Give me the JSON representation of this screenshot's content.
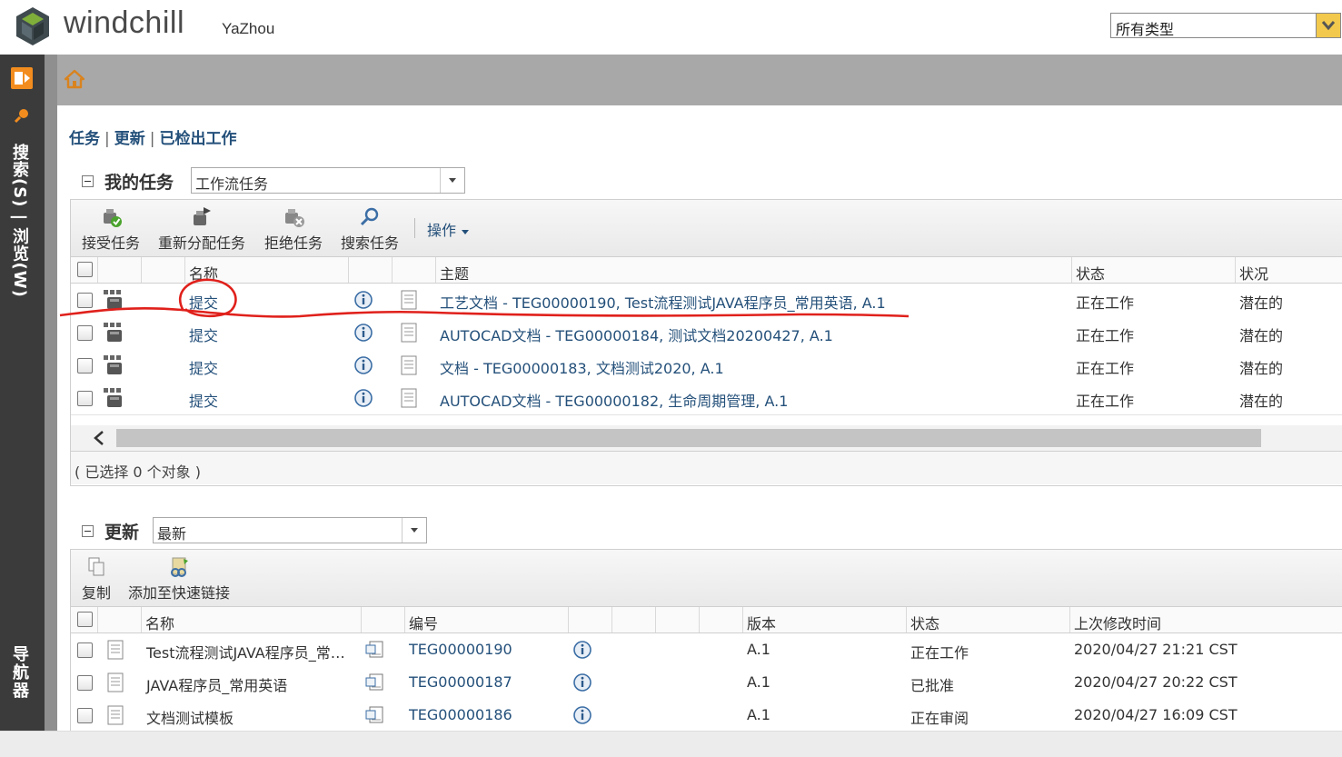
{
  "header": {
    "brand": "windchill",
    "user": "YaZhou",
    "type_select": "所有类型"
  },
  "rail": {
    "search_label": "搜索(S) | 浏览(W)",
    "nav_label": "导航器"
  },
  "breadcrumb": {
    "tasks": "任务",
    "updates": "更新",
    "checked_out": "已检出工作"
  },
  "my_tasks": {
    "title": "我的任务",
    "filter": "工作流任务",
    "toolbar": {
      "accept": "接受任务",
      "reassign": "重新分配任务",
      "reject": "拒绝任务",
      "search": "搜索任务",
      "actions": "操作"
    },
    "columns": {
      "name": "名称",
      "subject": "主题",
      "state": "状态",
      "status": "状况"
    },
    "rows": [
      {
        "name": "提交",
        "subject": "工艺文档 - TEG00000190, Test流程测试JAVA程序员_常用英语, A.1",
        "state": "正在工作",
        "status": "潜在的"
      },
      {
        "name": "提交",
        "subject": "AUTOCAD文档 - TEG00000184, 测试文档20200427, A.1",
        "state": "正在工作",
        "status": "潜在的"
      },
      {
        "name": "提交",
        "subject": "文档 - TEG00000183, 文档测试2020, A.1",
        "state": "正在工作",
        "status": "潜在的"
      },
      {
        "name": "提交",
        "subject": "AUTOCAD文档 - TEG00000182, 生命周期管理, A.1",
        "state": "正在工作",
        "status": "潜在的"
      }
    ],
    "selection": "( 已选择 0 个对象 )"
  },
  "updates": {
    "title": "更新",
    "filter": "最新",
    "toolbar": {
      "copy": "复制",
      "add_quick_link": "添加至快速链接"
    },
    "columns": {
      "name": "名称",
      "number": "编号",
      "version": "版本",
      "state": "状态",
      "modified": "上次修改时间"
    },
    "rows": [
      {
        "name": "Test流程测试JAVA程序员_常…",
        "number": "TEG00000190",
        "version": "A.1",
        "state": "正在工作",
        "modified": "2020/04/27 21:21 CST"
      },
      {
        "name": "JAVA程序员_常用英语",
        "number": "TEG00000187",
        "version": "A.1",
        "state": "已批准",
        "modified": "2020/04/27 20:22 CST"
      },
      {
        "name": "文档测试模板",
        "number": "TEG00000186",
        "version": "A.1",
        "state": "正在审阅",
        "modified": "2020/04/27 16:09 CST"
      }
    ]
  },
  "colors": {
    "link": "#24507a",
    "annotation": "#e0201b",
    "rail": "#3b3b3b",
    "accent": "#f28c1e"
  }
}
